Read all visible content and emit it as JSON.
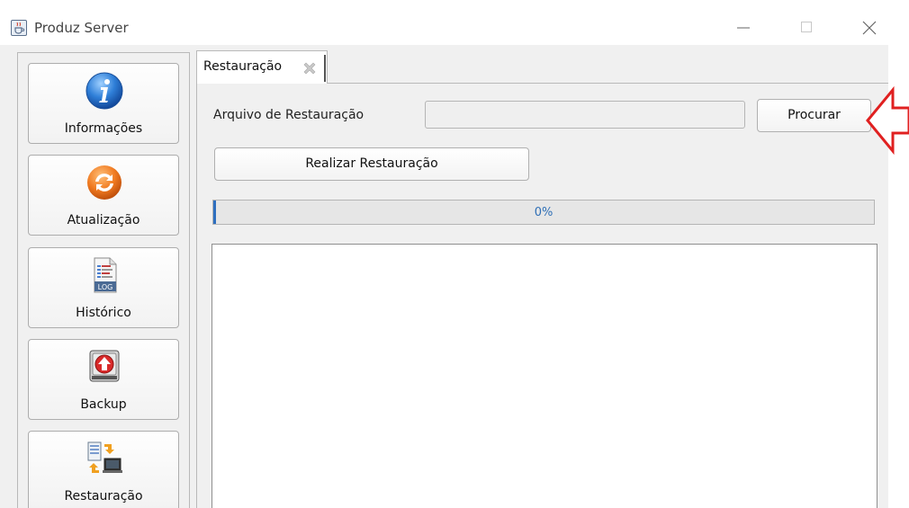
{
  "window": {
    "title": "Produz Server",
    "app_icon": "java-cup-icon",
    "controls": [
      "minimize-icon",
      "maximize-icon",
      "close-icon"
    ]
  },
  "sidebar": {
    "items": [
      {
        "label": "Informações",
        "icon": "info-icon"
      },
      {
        "label": "Atualização",
        "icon": "refresh-icon"
      },
      {
        "label": "Histórico",
        "icon": "log-file-icon"
      },
      {
        "label": "Backup",
        "icon": "backup-drive-icon"
      },
      {
        "label": "Restauração",
        "icon": "restore-icon"
      }
    ]
  },
  "tabs": [
    {
      "label": "Restauração",
      "closable": true
    }
  ],
  "restore": {
    "file_label": "Arquivo de Restauração",
    "file_value": "",
    "browse_label": "Procurar",
    "run_label": "Realizar Restauração",
    "progress_text": "0%",
    "progress_value": 0,
    "log_text": ""
  },
  "colors": {
    "progress_text": "#2f6fb6",
    "annotation_arrow": "#e02020",
    "panel_background": "#f0f0f0"
  }
}
